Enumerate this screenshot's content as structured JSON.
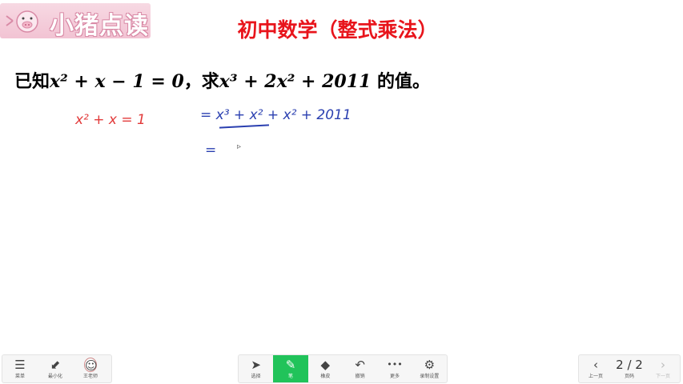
{
  "logo": {
    "text": "小猪点读"
  },
  "title": "初中数学（整式乘法）",
  "problem": {
    "prefix": "已知",
    "condition": "x² + x − 1 = 0",
    "sep": "，求",
    "expression": "x³ + 2x² + 2011",
    "suffix": " 的值。"
  },
  "handwriting": {
    "red_line": "x² + x = 1",
    "blue_line1": "= x³ + x² + x² + 2011",
    "blue_line2": "="
  },
  "toolbar": {
    "left": [
      {
        "icon": "menu-icon",
        "glyph": "☰",
        "label": "菜单"
      },
      {
        "icon": "minimize-icon",
        "glyph": "⬋",
        "label": "最小化"
      },
      {
        "icon": "teacher-avatar",
        "glyph": "☺",
        "label": "王老师"
      }
    ],
    "middle": [
      {
        "icon": "select-cursor-icon",
        "glyph": "➤",
        "label": "选择"
      },
      {
        "icon": "pen-icon",
        "glyph": "✎",
        "label": "笔"
      },
      {
        "icon": "eraser-icon",
        "glyph": "◆",
        "label": "橡皮"
      },
      {
        "icon": "undo-icon",
        "glyph": "↶",
        "label": "撤销"
      },
      {
        "icon": "more-icon",
        "glyph": "•••",
        "label": "更多"
      },
      {
        "icon": "record-settings-icon",
        "glyph": "⚙",
        "label": "录制设置"
      }
    ],
    "right": {
      "prev_label": "上一页",
      "page_value": "2 / 2",
      "page_label": "页码",
      "next_label": "下一页"
    }
  },
  "colors": {
    "title": "#e8141b",
    "accent_active": "#21c35a",
    "handwriting_red": "#e23a3a",
    "handwriting_blue": "#2a3fb0"
  }
}
